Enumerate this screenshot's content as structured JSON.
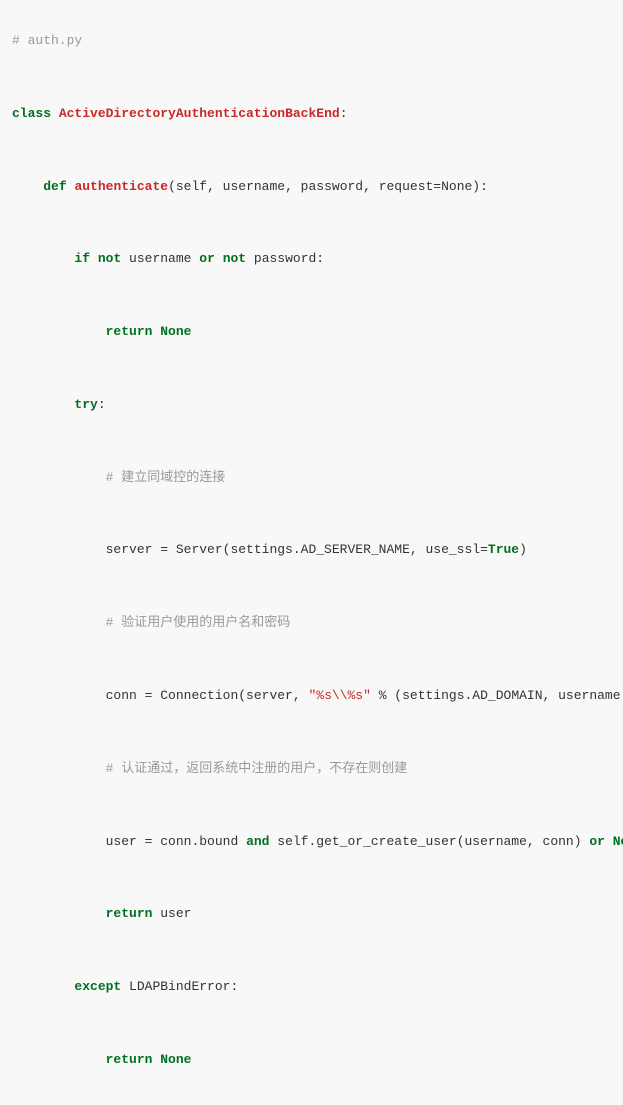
{
  "file_comment": "# auth.py",
  "kw": {
    "class": "class",
    "def": "def",
    "if": "if",
    "not": "not",
    "or": "or",
    "and": "and",
    "return": "return",
    "try": "try",
    "except": "except"
  },
  "bool": {
    "true": "True",
    "none": "None"
  },
  "class_name": "ActiveDirectoryAuthenticationBackEnd",
  "func_name": "authenticate",
  "params": "(self, username, password, request=None):",
  "cond": {
    "p1": " username ",
    "p2": " password:"
  },
  "ret_none_tail": "",
  "try_colon": ":",
  "cmt1": "# 建立同域控的连接",
  "srv_line": {
    "lhs": "server = Server(settings.AD_SERVER_NAME, use_ssl=",
    "rhs": ")"
  },
  "cmt2": "# 验证用户使用的用户名和密码",
  "conn_line": {
    "lhs": "conn = Connection(server, ",
    "str": "\"%s\\\\%s\"",
    "rhs": " % (settings.AD_DOMAIN, username), passwo"
  },
  "cmt3": "# 认证通过，返回系统中注册的用户，不存在则创建",
  "user_line": {
    "lhs": "user = conn.bound ",
    "mid": " self.get_or_create_user(username, conn) ",
    "tail": " "
  },
  "ret_user": " user",
  "except_tail": " LDAPBindError:",
  "colon": ":"
}
